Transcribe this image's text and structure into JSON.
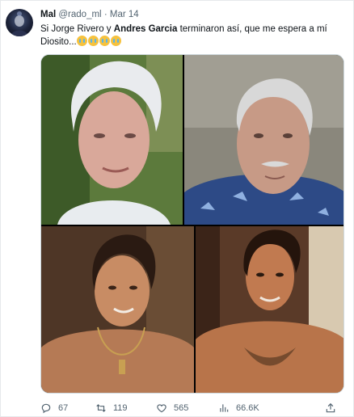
{
  "tweet": {
    "author_name": "Mal",
    "handle": "@rado_ml",
    "separator": "·",
    "date": "Mar 14",
    "text_part1": "Si Jorge Rivero y ",
    "text_bold": "Andres Garcia",
    "text_part2": " terminaron así, que me espera a mí Diosito...",
    "emojis": [
      "crying-face",
      "crying-face",
      "crying-face",
      "crying-face"
    ]
  },
  "media": {
    "photos": [
      {
        "icon": "old-man-white-hair-photo"
      },
      {
        "icon": "old-man-hawaiian-shirt-photo"
      },
      {
        "icon": "young-man-necklace-photo"
      },
      {
        "icon": "young-man-shirtless-photo"
      }
    ]
  },
  "actions": {
    "replies": "67",
    "retweets": "119",
    "likes": "565",
    "views": "66.6K"
  },
  "colors": {
    "text": "#0f1419",
    "secondary": "#536471",
    "border": "#cfd9de"
  }
}
